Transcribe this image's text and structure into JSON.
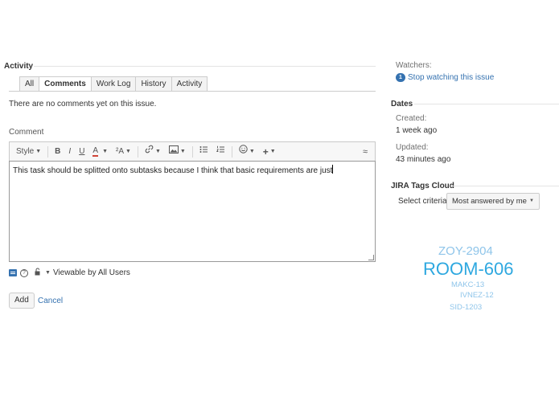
{
  "activity": {
    "title": "Activity",
    "tabs": [
      {
        "label": "All",
        "active": false
      },
      {
        "label": "Comments",
        "active": true
      },
      {
        "label": "Work Log",
        "active": false
      },
      {
        "label": "History",
        "active": false
      },
      {
        "label": "Activity",
        "active": false
      }
    ],
    "empty_message": "There are no comments yet on this issue."
  },
  "comment": {
    "label": "Comment",
    "toolbar": {
      "style_label": "Style",
      "bold": "B",
      "italic": "I",
      "underline": "U",
      "text_color": "A",
      "more_formatting": "²A",
      "collapse": "≈"
    },
    "text": "This task should be splitted onto subtasks because I think that basic requirements are just",
    "visibility_label": "Viewable by All Users",
    "add_button": "Add",
    "cancel_link": "Cancel"
  },
  "people": {
    "watchers_label": "Watchers:",
    "watch_count": "1",
    "stop_watching_link": "Stop watching this issue"
  },
  "dates": {
    "title": "Dates",
    "created_label": "Created:",
    "created_value": "1 week ago",
    "updated_label": "Updated:",
    "updated_value": "43 minutes ago"
  },
  "tags_cloud": {
    "title": "JIRA Tags Cloud",
    "criteria_label": "Select criteria",
    "criteria_value": "Most answered by me",
    "tags": [
      {
        "text": "ZOY-2904"
      },
      {
        "text": "ROOM-606"
      },
      {
        "text": "MAKC-13"
      },
      {
        "text": "IVNEZ-12"
      },
      {
        "text": "SID-1203"
      }
    ]
  },
  "colors": {
    "link": "#3572b0",
    "tag": "#8fc5ea",
    "border": "#cccccc"
  }
}
